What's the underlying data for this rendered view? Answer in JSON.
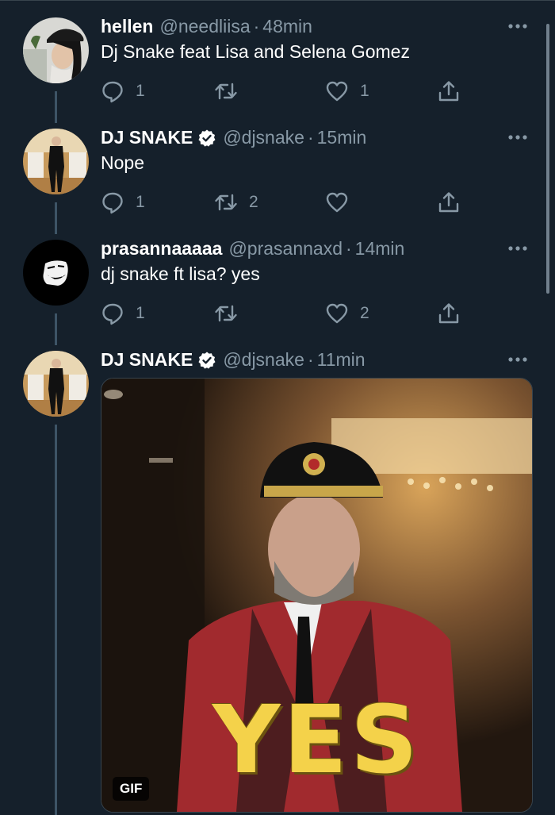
{
  "colors": {
    "background": "#15202b",
    "secondary_text": "#8899a6",
    "verified_badge": "#ffffff",
    "thread_line": "#3d5466"
  },
  "tweets": [
    {
      "name": "hellen",
      "handle": "@needliisa",
      "separator": "·",
      "time": "48min",
      "text": "Dj Snake feat Lisa and Selena Gomez",
      "verified": false,
      "avatar_icon": "woman-in-cap-avatar",
      "replies": "1",
      "retweets": "",
      "likes": "1"
    },
    {
      "name": "DJ SNAKE",
      "handle": "@djsnake",
      "separator": "·",
      "time": "15min",
      "text": "Nope",
      "verified": true,
      "avatar_icon": "man-standing-avatar",
      "replies": "1",
      "retweets": "2",
      "likes": ""
    },
    {
      "name": "prasannaaaaa",
      "handle": "@prasannaxd",
      "separator": "·",
      "time": "14min",
      "text": "dj snake ft lisa? yes",
      "verified": false,
      "avatar_icon": "trollface-avatar",
      "replies": "1",
      "retweets": "",
      "likes": "2"
    },
    {
      "name": "DJ SNAKE",
      "handle": "@djsnake",
      "separator": "·",
      "time": "11min",
      "text": "",
      "verified": true,
      "avatar_icon": "man-standing-avatar",
      "media": {
        "type": "gif",
        "badge": "GIF",
        "caption": "YES"
      }
    }
  ]
}
